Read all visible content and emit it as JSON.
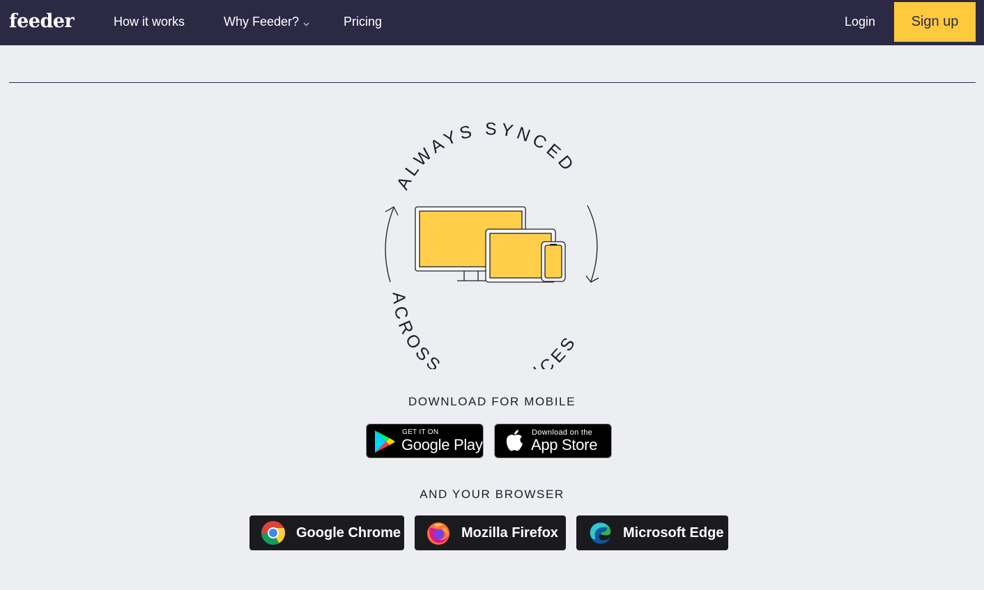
{
  "nav": {
    "logo": "feeder",
    "how_it_works": "How it works",
    "why_feeder": "Why Feeder?",
    "pricing": "Pricing",
    "login": "Login",
    "signup": "Sign up"
  },
  "illustration": {
    "top_arc_text": "ALWAYS SYNCED",
    "bottom_arc_text": "ACROSS ALL DEVICES"
  },
  "mobile": {
    "heading": "DOWNLOAD FOR MOBILE",
    "google_play": {
      "small": "GET IT ON",
      "big": "Google Play"
    },
    "app_store": {
      "small": "Download on the",
      "big": "App Store"
    }
  },
  "browser": {
    "heading": "AND YOUR BROWSER",
    "buttons": [
      {
        "label": "Google Chrome",
        "icon": "chrome-icon"
      },
      {
        "label": "Mozilla Firefox",
        "icon": "firefox-icon"
      },
      {
        "label": "Microsoft Edge",
        "icon": "edge-icon"
      }
    ]
  },
  "colors": {
    "nav_bg": "#2c2945",
    "accent_yellow": "#ffc93c",
    "device_yellow": "#ffce4a",
    "page_bg": "#eceef1"
  }
}
